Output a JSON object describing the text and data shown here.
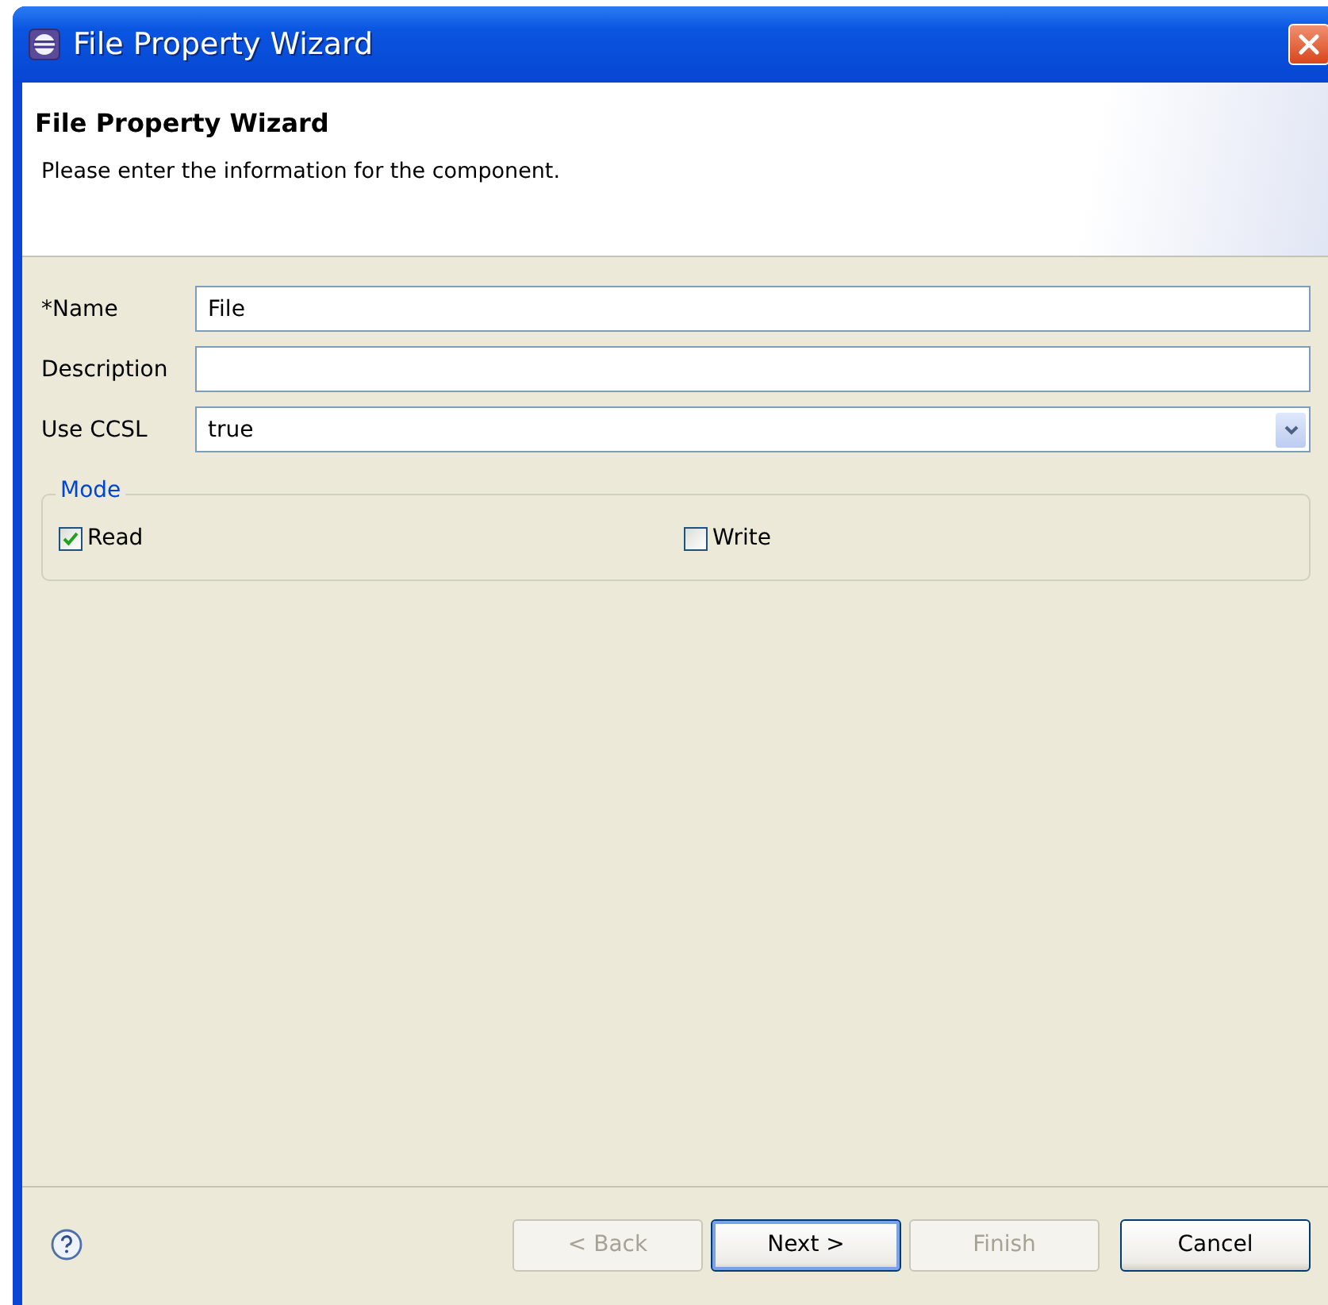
{
  "window": {
    "title": "File Property Wizard"
  },
  "header": {
    "title": "File Property Wizard",
    "message": "Please enter the information for the component."
  },
  "fields": [
    {
      "kind": "text",
      "label": "*Name",
      "value": "File"
    },
    {
      "kind": "text",
      "label": "Description"
    },
    {
      "kind": "combo",
      "label": "Use CCSL",
      "value": "true"
    }
  ],
  "group": {
    "title": "Mode",
    "options": [
      {
        "label": "Read",
        "checked": true
      },
      {
        "label": "Write",
        "checked": false
      }
    ]
  },
  "buttons": [
    {
      "label": "< Back",
      "disabled": true,
      "default": false
    },
    {
      "label": "Next >",
      "disabled": false,
      "default": true
    },
    {
      "label": "Finish",
      "disabled": true,
      "default": false
    },
    {
      "label": "Cancel",
      "disabled": false,
      "default": false
    }
  ]
}
